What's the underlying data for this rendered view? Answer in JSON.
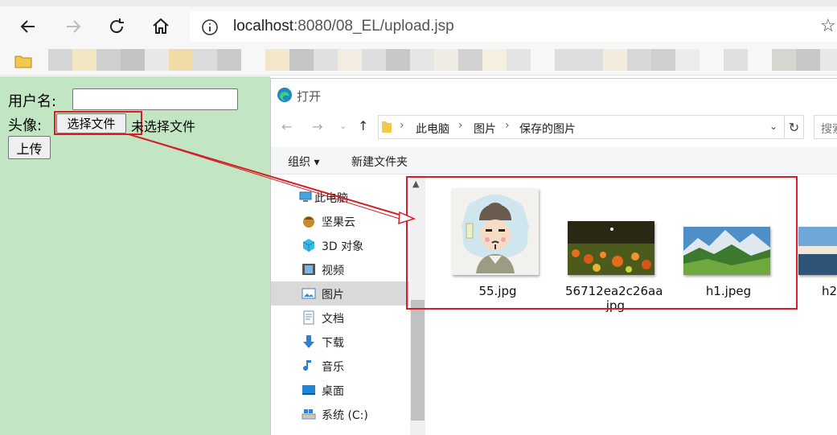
{
  "browser": {
    "url_host": "localhost",
    "url_rest": ":8080/08_EL/upload.jsp"
  },
  "page": {
    "username_label": "用户名:",
    "avatar_label": "头像:",
    "choose_file_label": "选择文件",
    "no_file_label": "未选择文件",
    "upload_label": "上传"
  },
  "dialog": {
    "title": "打开",
    "path": [
      "此电脑",
      "图片",
      "保存的图片"
    ],
    "search_placeholder": "搜索",
    "commands": {
      "organize": "组织 ▾",
      "new_folder": "新建文件夹"
    },
    "nav_items": [
      {
        "label": "此电脑",
        "icon": "computer-icon"
      },
      {
        "label": "坚果云",
        "icon": "nutstore-icon"
      },
      {
        "label": "3D 对象",
        "icon": "3d-objects-icon"
      },
      {
        "label": "视频",
        "icon": "video-icon"
      },
      {
        "label": "图片",
        "icon": "pictures-icon"
      },
      {
        "label": "文档",
        "icon": "documents-icon"
      },
      {
        "label": "下载",
        "icon": "download-icon"
      },
      {
        "label": "音乐",
        "icon": "music-icon"
      },
      {
        "label": "桌面",
        "icon": "desktop-icon"
      },
      {
        "label": "系统 (C:)",
        "icon": "drive-icon"
      }
    ],
    "files": [
      {
        "name": "55.jpg"
      },
      {
        "name": "56712ea2c26aa.jpg"
      },
      {
        "name": "h1.jpeg"
      },
      {
        "name": "h2"
      }
    ]
  },
  "colors": {
    "page_bg": "#c2e6c3",
    "annotation_red": "#d32027",
    "selected_nav": "#d9d9d9"
  }
}
